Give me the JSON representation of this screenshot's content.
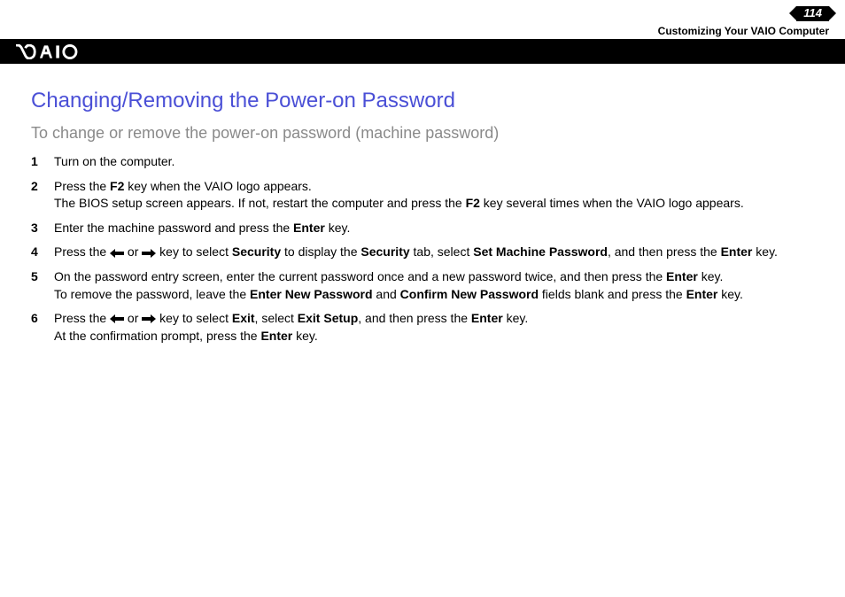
{
  "header": {
    "page_number": "114",
    "section_title": "Customizing Your VAIO Computer"
  },
  "content": {
    "heading": "Changing/Removing the Power-on Password",
    "subheading": "To change or remove the power-on password (machine password)",
    "steps": [
      {
        "num": "1",
        "parts": [
          {
            "t": "Turn on the computer.",
            "b": false
          }
        ]
      },
      {
        "num": "2",
        "parts": [
          {
            "t": "Press the ",
            "b": false
          },
          {
            "t": "F2",
            "b": true
          },
          {
            "t": " key when the VAIO logo appears.",
            "b": false
          },
          {
            "t": "\nThe BIOS setup screen appears. If not, restart the computer and press the ",
            "b": false
          },
          {
            "t": "F2",
            "b": true
          },
          {
            "t": " key several times when the VAIO logo appears.",
            "b": false
          }
        ]
      },
      {
        "num": "3",
        "parts": [
          {
            "t": "Enter the machine password and press the ",
            "b": false
          },
          {
            "t": "Enter",
            "b": true
          },
          {
            "t": " key.",
            "b": false
          }
        ]
      },
      {
        "num": "4",
        "parts": [
          {
            "t": "Press the ",
            "b": false
          },
          {
            "icon": "arrow-left"
          },
          {
            "t": " or ",
            "b": false
          },
          {
            "icon": "arrow-right"
          },
          {
            "t": " key to select ",
            "b": false
          },
          {
            "t": "Security",
            "b": true
          },
          {
            "t": " to display the ",
            "b": false
          },
          {
            "t": "Security",
            "b": true
          },
          {
            "t": " tab, select ",
            "b": false
          },
          {
            "t": "Set Machine Password",
            "b": true
          },
          {
            "t": ", and then press the ",
            "b": false
          },
          {
            "t": "Enter",
            "b": true
          },
          {
            "t": " key.",
            "b": false
          }
        ]
      },
      {
        "num": "5",
        "parts": [
          {
            "t": "On the password entry screen, enter the current password once and a new password twice, and then press the ",
            "b": false
          },
          {
            "t": "Enter",
            "b": true
          },
          {
            "t": " key.\nTo remove the password, leave the ",
            "b": false
          },
          {
            "t": "Enter New Password",
            "b": true
          },
          {
            "t": " and ",
            "b": false
          },
          {
            "t": "Confirm New Password",
            "b": true
          },
          {
            "t": " fields blank and press the ",
            "b": false
          },
          {
            "t": "Enter",
            "b": true
          },
          {
            "t": " key.",
            "b": false
          }
        ]
      },
      {
        "num": "6",
        "parts": [
          {
            "t": "Press the ",
            "b": false
          },
          {
            "icon": "arrow-left"
          },
          {
            "t": " or ",
            "b": false
          },
          {
            "icon": "arrow-right"
          },
          {
            "t": " key to select ",
            "b": false
          },
          {
            "t": "Exit",
            "b": true
          },
          {
            "t": ", select ",
            "b": false
          },
          {
            "t": "Exit Setup",
            "b": true
          },
          {
            "t": ", and then press the ",
            "b": false
          },
          {
            "t": "Enter",
            "b": true
          },
          {
            "t": " key.\nAt the confirmation prompt, press the ",
            "b": false
          },
          {
            "t": "Enter",
            "b": true
          },
          {
            "t": " key.",
            "b": false
          }
        ]
      }
    ]
  }
}
